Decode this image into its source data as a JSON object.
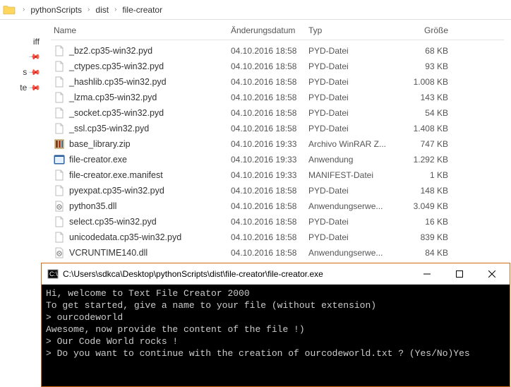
{
  "breadcrumb": {
    "items": [
      "pythonScripts",
      "dist",
      "file-creator"
    ]
  },
  "sidebar": {
    "items": [
      {
        "label": "iff"
      },
      {
        "label": "s"
      },
      {
        "label": "te"
      }
    ]
  },
  "columns": {
    "name": "Name",
    "date": "Änderungsdatum",
    "type": "Typ",
    "size": "Größe"
  },
  "files": [
    {
      "icon": "file",
      "name": "_bz2.cp35-win32.pyd",
      "date": "04.10.2016 18:58",
      "type": "PYD-Datei",
      "size": "68 KB"
    },
    {
      "icon": "file",
      "name": "_ctypes.cp35-win32.pyd",
      "date": "04.10.2016 18:58",
      "type": "PYD-Datei",
      "size": "93 KB"
    },
    {
      "icon": "file",
      "name": "_hashlib.cp35-win32.pyd",
      "date": "04.10.2016 18:58",
      "type": "PYD-Datei",
      "size": "1.008 KB"
    },
    {
      "icon": "file",
      "name": "_lzma.cp35-win32.pyd",
      "date": "04.10.2016 18:58",
      "type": "PYD-Datei",
      "size": "143 KB"
    },
    {
      "icon": "file",
      "name": "_socket.cp35-win32.pyd",
      "date": "04.10.2016 18:58",
      "type": "PYD-Datei",
      "size": "54 KB"
    },
    {
      "icon": "file",
      "name": "_ssl.cp35-win32.pyd",
      "date": "04.10.2016 18:58",
      "type": "PYD-Datei",
      "size": "1.408 KB"
    },
    {
      "icon": "zip",
      "name": "base_library.zip",
      "date": "04.10.2016 19:33",
      "type": "Archivo WinRAR Z...",
      "size": "747 KB"
    },
    {
      "icon": "exe",
      "name": "file-creator.exe",
      "date": "04.10.2016 19:33",
      "type": "Anwendung",
      "size": "1.292 KB"
    },
    {
      "icon": "file",
      "name": "file-creator.exe.manifest",
      "date": "04.10.2016 19:33",
      "type": "MANIFEST-Datei",
      "size": "1 KB"
    },
    {
      "icon": "file",
      "name": "pyexpat.cp35-win32.pyd",
      "date": "04.10.2016 18:58",
      "type": "PYD-Datei",
      "size": "148 KB"
    },
    {
      "icon": "dll",
      "name": "python35.dll",
      "date": "04.10.2016 18:58",
      "type": "Anwendungserwe...",
      "size": "3.049 KB"
    },
    {
      "icon": "file",
      "name": "select.cp35-win32.pyd",
      "date": "04.10.2016 18:58",
      "type": "PYD-Datei",
      "size": "16 KB"
    },
    {
      "icon": "file",
      "name": "unicodedata.cp35-win32.pyd",
      "date": "04.10.2016 18:58",
      "type": "PYD-Datei",
      "size": "839 KB"
    },
    {
      "icon": "dll",
      "name": "VCRUNTIME140.dll",
      "date": "04.10.2016 18:58",
      "type": "Anwendungserwe...",
      "size": "84 KB"
    }
  ],
  "console": {
    "title": "C:\\Users\\sdkca\\Desktop\\pythonScripts\\dist\\file-creator\\file-creator.exe",
    "lines": [
      "Hi, welcome to Text File Creator 2000",
      "To get started, give a name to your file (without extension)",
      "> ourcodeworld",
      "Awesome, now provide the content of the file !)",
      "> Our Code World rocks !",
      "> Do you want to continue with the creation of ourcodeworld.txt ? (Yes/No)Yes"
    ]
  }
}
